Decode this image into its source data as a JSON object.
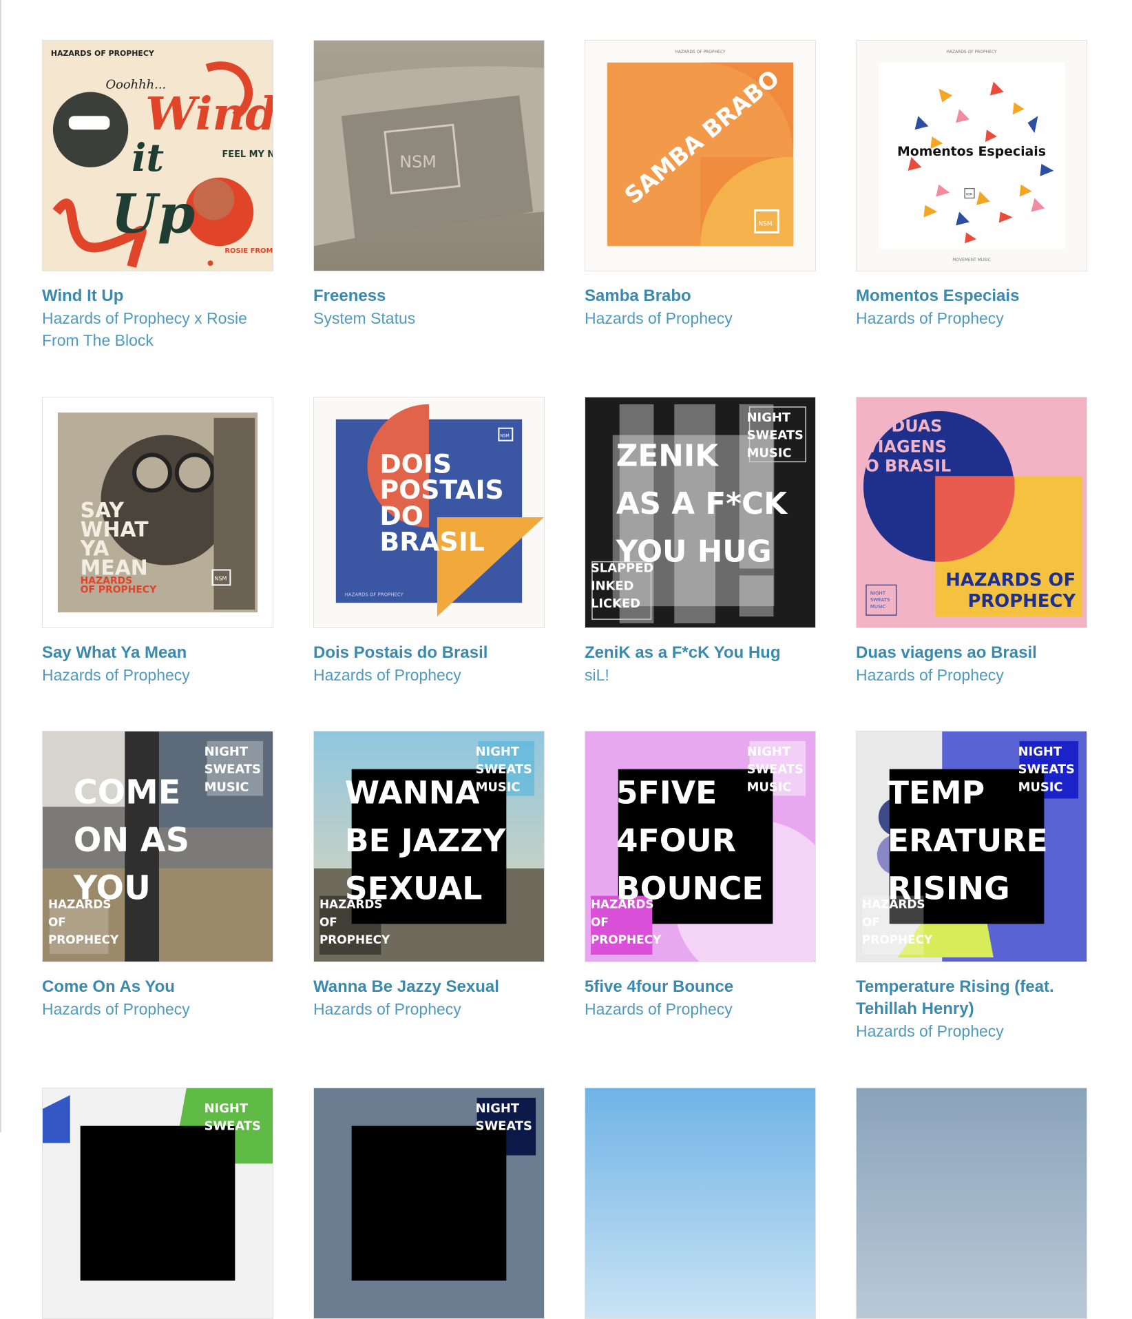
{
  "colors": {
    "link": "#3b89ad",
    "artist": "#4f9abf"
  },
  "albums": [
    {
      "title": "Wind It Up",
      "artist": "Hazards of Prophecy x Rosie From The Block",
      "art_text": {
        "label": "HAZARDS OF PROPHECY",
        "tag": "Ooohhh...",
        "t1": "Wind",
        "t2": "it",
        "t3": "Up",
        "nrg": "FEEL MY NRG",
        "rosie": "ROSIE FROM THE BLOCK"
      }
    },
    {
      "title": "Freeness",
      "artist": "System Status",
      "art_text": {
        "logo": "NSM"
      }
    },
    {
      "title": "Samba Brabo",
      "artist": "Hazards of Prophecy",
      "art_text": {
        "top": "HAZARDS OF PROPHECY",
        "main": "SAMBA BRABO",
        "logo": "NSM"
      }
    },
    {
      "title": "Momentos Especiais",
      "artist": "Hazards of Prophecy",
      "art_text": {
        "top": "HAZARDS OF PROPHECY",
        "main": "Momentos Especiais",
        "bottom": "MOVEMENT MUSIC",
        "logo": "NSM"
      }
    },
    {
      "title": "Say What Ya Mean",
      "artist": "Hazards of Prophecy",
      "art_text": {
        "l1": "SAY",
        "l2": "WHAT",
        "l3": "YA",
        "l4": "MEAN",
        "l5": "HAZARDS",
        "l6": "OF PROPHECY",
        "logo": "NSM"
      }
    },
    {
      "title": "Dois Postais do Brasil",
      "artist": "Hazards of Prophecy",
      "art_text": {
        "l1": "DOIS",
        "l2": "POSTAIS",
        "l3": "DO",
        "l4": "BRASIL",
        "bottom": "HAZARDS OF PROPHECY",
        "logo": "NSM"
      }
    },
    {
      "title": "ZeniK as a F*cK You Hug",
      "artist": "siL!",
      "art_text": {
        "l1": "ZENIK",
        "l2": "AS A F*CK",
        "l3": "YOU HUG",
        "n1": "NIGHT",
        "n2": "SWEATS",
        "n3": "MUSIC",
        "s1": "SLAPPED",
        "s2": "INKED",
        "s3": "LICKED"
      }
    },
    {
      "title": "Duas viagens ao Brasil",
      "artist": "Hazards of Prophecy",
      "art_text": {
        "l1": "DUAS",
        "l2": "VIAGENS",
        "l3": "AO BRASIL",
        "b1": "HAZARDS OF",
        "b2": "PROPHECY",
        "n1": "NIGHT",
        "n2": "SWEATS",
        "n3": "MUSIC"
      }
    },
    {
      "title": "Come On As You",
      "artist": "Hazards of Prophecy",
      "art_text": {
        "l1": "COME",
        "l2": "ON AS",
        "l3": "YOU",
        "n1": "NIGHT",
        "n2": "SWEATS",
        "n3": "MUSIC",
        "h1": "HAZARDS",
        "h2": "OF",
        "h3": "PROPHECY"
      }
    },
    {
      "title": "Wanna Be Jazzy Sexual",
      "artist": "Hazards of Prophecy",
      "art_text": {
        "l1": "WANNA",
        "l2": "BE JAZZY",
        "l3": "SEXUAL",
        "n1": "NIGHT",
        "n2": "SWEATS",
        "n3": "MUSIC",
        "h1": "HAZARDS",
        "h2": "OF",
        "h3": "PROPHECY"
      }
    },
    {
      "title": "5five 4four Bounce",
      "artist": "Hazards of Prophecy",
      "art_text": {
        "l1": "5FIVE",
        "l2": "4FOUR",
        "l3": "BOUNCE",
        "n1": "NIGHT",
        "n2": "SWEATS",
        "n3": "MUSIC",
        "h1": "HAZARDS",
        "h2": "OF",
        "h3": "PROPHECY"
      }
    },
    {
      "title": "Temperature Rising (feat. Tehillah Henry)",
      "artist": "Hazards of Prophecy",
      "art_text": {
        "l1": "TEMP",
        "l2": "ERATURE",
        "l3": "RISING",
        "n1": "NIGHT",
        "n2": "SWEATS",
        "n3": "MUSIC",
        "h1": "HAZARDS",
        "h2": "OF",
        "h3": "PROPHECY"
      }
    },
    {
      "art_text": {
        "n1": "NIGHT",
        "n2": "SWEATS"
      }
    },
    {
      "art_text": {
        "n1": "NIGHT",
        "n2": "SWEATS"
      }
    },
    {
      "art_text": {}
    },
    {
      "art_text": {}
    }
  ]
}
